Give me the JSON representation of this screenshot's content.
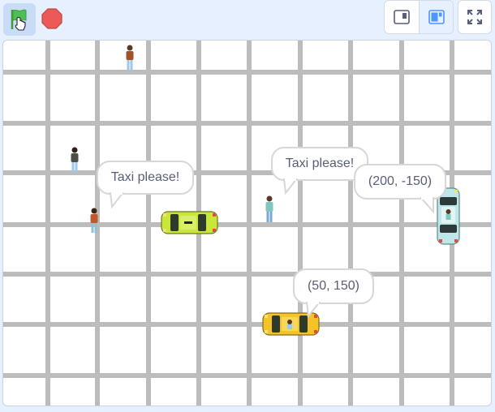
{
  "toolbar": {
    "green_flag": {
      "icon": "green-flag-icon",
      "color": "#4cbf56"
    },
    "stop": {
      "icon": "stop-sign-icon",
      "color": "#ec5959"
    },
    "small_stage": {
      "icon": "small-stage-icon"
    },
    "normal_stage": {
      "icon": "normal-stage-icon"
    },
    "fullscreen": {
      "icon": "fullscreen-icon"
    }
  },
  "stage": {
    "bubbles": [
      {
        "text": "Taxi please!"
      },
      {
        "text": "Taxi please!"
      },
      {
        "text": "(200, -150)"
      },
      {
        "text": "(50, 150)"
      }
    ],
    "taxis": [
      {
        "color": "#c9e63a",
        "sprite": "taxi-green"
      },
      {
        "color": "#f3c327",
        "sprite": "taxi-yellow"
      },
      {
        "color": "#bfe6e8",
        "sprite": "taxi-teal"
      }
    ],
    "people_count_sprites": [
      "person-1",
      "person-2",
      "person-3",
      "person-4"
    ]
  }
}
